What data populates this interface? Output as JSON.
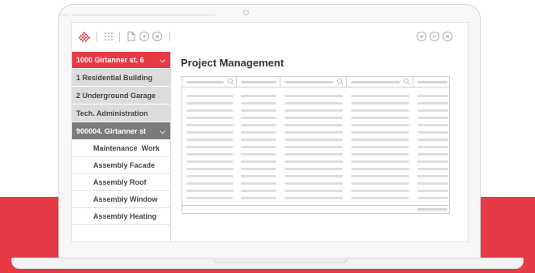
{
  "colors": {
    "accent": "#e63a45",
    "sidebar_selected_gray": "#dcdcdc",
    "sidebar_group_dark": "#7a7a7a"
  },
  "toolbar": {
    "logo_icon": "diamond-logo-icon",
    "left_icons": [
      "grid-icon",
      "document-icon",
      "plus-circle-icon",
      "close-circle-icon"
    ],
    "right_icons": [
      "plus-circle-icon",
      "minus-circle-icon",
      "close-circle-icon"
    ]
  },
  "sidebar": {
    "items": [
      {
        "label": "1000 Girtanner st. 6",
        "style": "red",
        "chevron": "⌵"
      },
      {
        "label": "1 Residential Building",
        "style": "gray"
      },
      {
        "label": "2 Underground Garage",
        "style": "gray"
      },
      {
        "label": "Tech. Administration",
        "style": "gray"
      },
      {
        "label": "900004. Girtanner st",
        "style": "dark",
        "chevron": "⌵"
      },
      {
        "label": "Maintenance  Work",
        "style": "sub"
      },
      {
        "label": "Assembly Facade",
        "style": "sub"
      },
      {
        "label": "Assembly Roof",
        "style": "sub"
      },
      {
        "label": "Assembly Window",
        "style": "sub"
      },
      {
        "label": "Assembly Heating",
        "style": "sub"
      }
    ]
  },
  "main": {
    "title": "Project Management",
    "table": {
      "columns": [
        "search-column",
        "column",
        "search-column",
        "search-column",
        "column"
      ],
      "placeholder_rows": 15
    }
  }
}
